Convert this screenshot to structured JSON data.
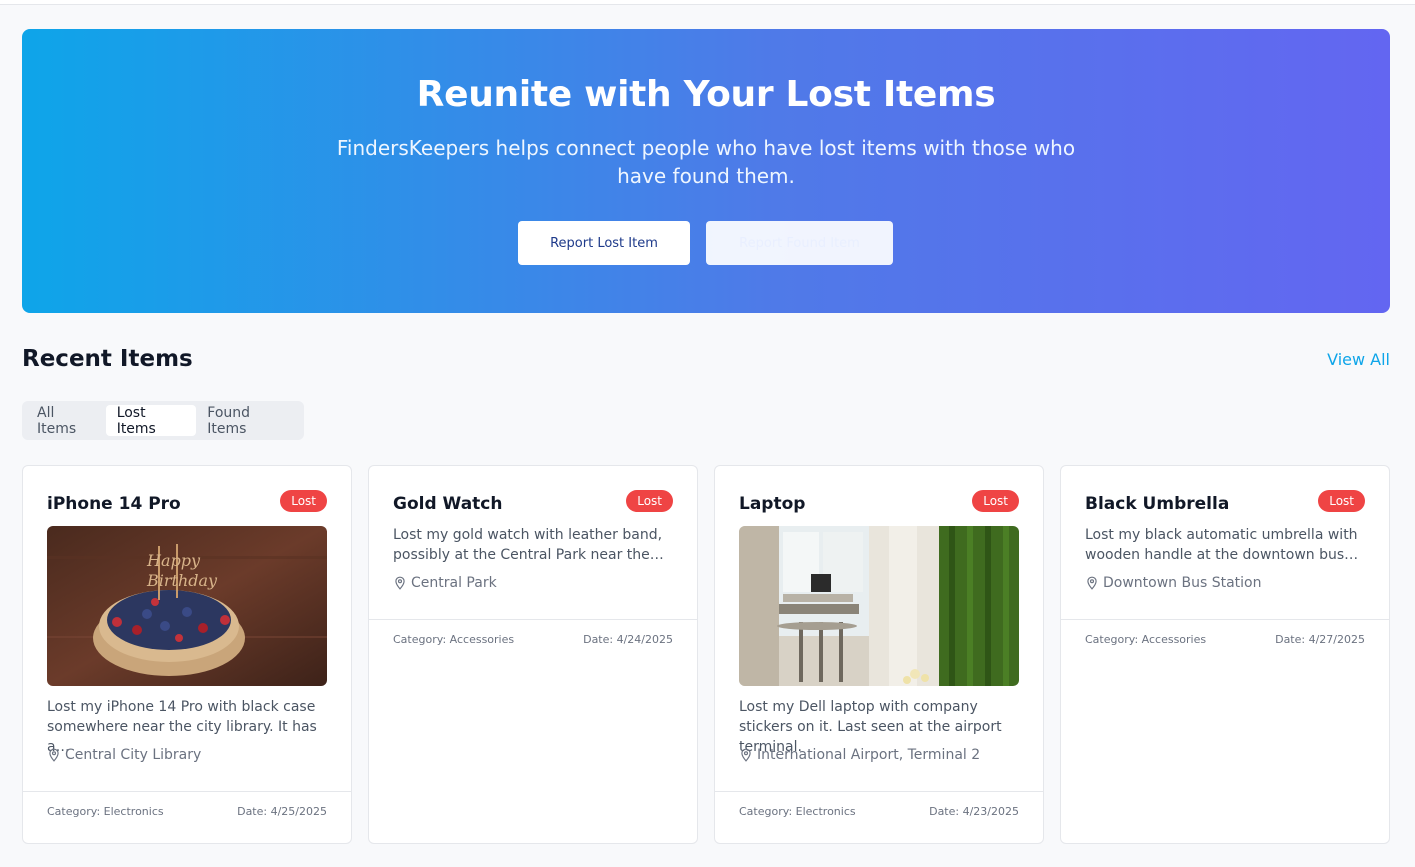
{
  "hero": {
    "title": "Reunite with Your Lost Items",
    "subtitle": "FindersKeepers helps connect people who have lost items with those who have found them.",
    "report_lost_label": "Report Lost Item",
    "report_found_label": "Report Found Item"
  },
  "recent": {
    "title": "Recent Items",
    "view_all_label": "View All",
    "tabs": [
      {
        "label": "All Items",
        "active": false
      },
      {
        "label": "Lost Items",
        "active": true
      },
      {
        "label": "Found Items",
        "active": false
      }
    ]
  },
  "items": [
    {
      "title": "iPhone 14 Pro",
      "status": "Lost",
      "image": "birthday-cake-photo",
      "description": "Lost my iPhone 14 Pro with black case somewhere near the city library. It has a…",
      "location": "Central City Library",
      "category": "Category: Electronics",
      "date": "Date: 4/25/2025"
    },
    {
      "title": "Gold Watch",
      "status": "Lost",
      "image": null,
      "description": "Lost my gold watch with leather band, possibly at the Central Park near the…",
      "location": "Central Park",
      "category": "Category: Accessories",
      "date": "Date: 4/24/2025"
    },
    {
      "title": "Laptop",
      "status": "Lost",
      "image": "cafe-interior-photo",
      "description": "Lost my Dell laptop with company stickers on it. Last seen at the airport terminal.",
      "location": "International Airport, Terminal 2",
      "category": "Category: Electronics",
      "date": "Date: 4/23/2025"
    },
    {
      "title": "Black Umbrella",
      "status": "Lost",
      "image": null,
      "description": "Lost my black automatic umbrella with wooden handle at the downtown bus…",
      "location": "Downtown Bus Station",
      "category": "Category: Accessories",
      "date": "Date: 4/27/2025"
    }
  ],
  "colors": {
    "hero_gradient_start": "#0ea5e9",
    "hero_gradient_end": "#6366f1",
    "badge_lost": "#ef4444",
    "link": "#0ea5e9"
  }
}
